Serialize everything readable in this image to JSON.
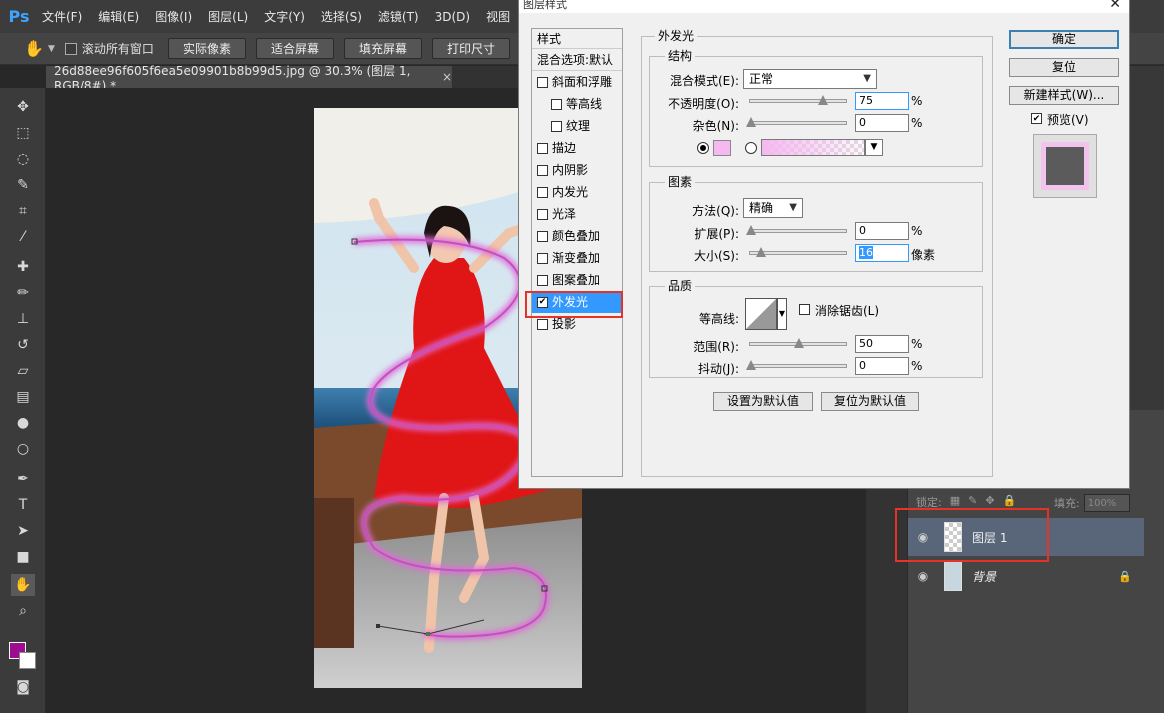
{
  "app": {
    "logo": "Ps",
    "menu": [
      "文件(F)",
      "编辑(E)",
      "图像(I)",
      "图层(L)",
      "文字(Y)",
      "选择(S)",
      "滤镜(T)",
      "3D(D)",
      "视图"
    ]
  },
  "options_bar": {
    "scroll_all_windows": "滚动所有窗口",
    "buttons": [
      "实际像素",
      "适合屏幕",
      "填充屏幕",
      "打印尺寸"
    ]
  },
  "document": {
    "tab_title": "26d88ee96f605f6ea5e09901b8b99d5.jpg @ 30.3% (图层 1, RGB/8#) *",
    "tab_close": "×"
  },
  "colors": {
    "foreground": "#9c0e8f",
    "background": "#ffffff",
    "glow_color": "#f5b8f0",
    "selection": "#3399ff",
    "highlight_box": "#e53327"
  },
  "layers_panel": {
    "lock_label": "锁定:",
    "fill_label": "填充:",
    "fill_value": "100%",
    "layers": [
      {
        "name": "图层 1",
        "selected": true
      },
      {
        "name": "背景",
        "locked": true
      }
    ]
  },
  "dialog": {
    "title": "图层样式",
    "close": "✕",
    "styles_header": "样式",
    "blend_options": "混合选项:默认",
    "style_items": [
      {
        "label": "斜面和浮雕",
        "checked": false
      },
      {
        "label": "等高线",
        "checked": false,
        "indent": true
      },
      {
        "label": "纹理",
        "checked": false,
        "indent": true
      },
      {
        "label": "描边",
        "checked": false
      },
      {
        "label": "内阴影",
        "checked": false
      },
      {
        "label": "内发光",
        "checked": false
      },
      {
        "label": "光泽",
        "checked": false
      },
      {
        "label": "颜色叠加",
        "checked": false
      },
      {
        "label": "渐变叠加",
        "checked": false
      },
      {
        "label": "图案叠加",
        "checked": false
      },
      {
        "label": "外发光",
        "checked": true,
        "selected": true
      },
      {
        "label": "投影",
        "checked": false
      }
    ],
    "outer_glow": {
      "title": "外发光",
      "structure": {
        "title": "结构",
        "blend_mode_label": "混合模式(E):",
        "blend_mode_value": "正常",
        "opacity_label": "不透明度(O):",
        "opacity_value": "75",
        "noise_label": "杂色(N):",
        "noise_value": "0",
        "percent": "%"
      },
      "elements": {
        "title": "图素",
        "technique_label": "方法(Q):",
        "technique_value": "精确",
        "spread_label": "扩展(P):",
        "spread_value": "0",
        "size_label": "大小(S):",
        "size_value": "16",
        "size_unit": "像素"
      },
      "quality": {
        "title": "品质",
        "contour_label": "等高线:",
        "antialias_label": "消除锯齿(L)",
        "range_label": "范围(R):",
        "range_value": "50",
        "jitter_label": "抖动(J):",
        "jitter_value": "0"
      },
      "set_default": "设置为默认值",
      "reset_default": "复位为默认值"
    },
    "buttons": {
      "ok": "确定",
      "reset": "复位",
      "new_style": "新建样式(W)...",
      "preview": "预览(V)"
    }
  }
}
